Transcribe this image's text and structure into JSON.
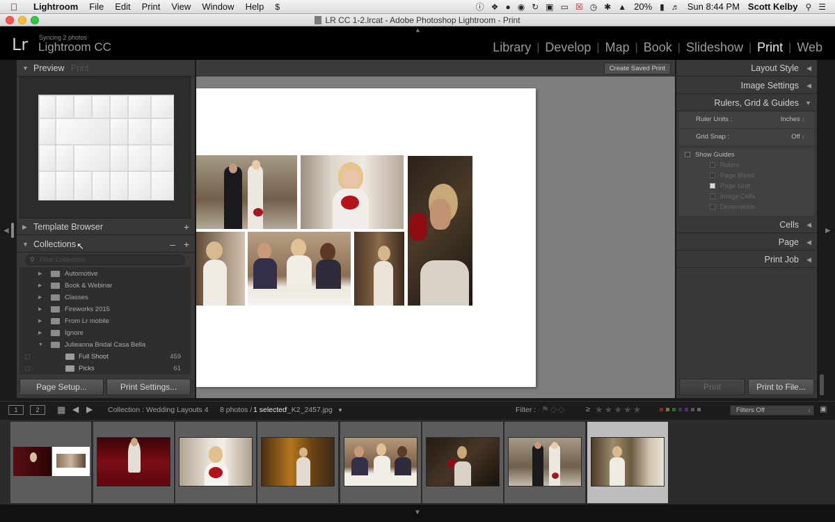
{
  "menubar": {
    "apple": "",
    "items": [
      "Lightroom",
      "File",
      "Edit",
      "Print",
      "View",
      "Window",
      "Help"
    ],
    "battery": "20%",
    "clock": "Sun 8:44 PM",
    "user": "Scott Kelby"
  },
  "window": {
    "title": "LR CC 1-2.lrcat - Adobe Photoshop Lightroom - Print"
  },
  "identity": {
    "logo": "Lr",
    "sync_status": "Syncing 2 photos",
    "product": "Lightroom CC"
  },
  "modules": [
    "Library",
    "Develop",
    "Map",
    "Book",
    "Slideshow",
    "Print",
    "Web"
  ],
  "active_module": "Print",
  "left_panel": {
    "preview": {
      "title": "Preview",
      "subtitle": "Print"
    },
    "template_browser": {
      "title": "Template Browser"
    },
    "collections": {
      "title": "Collections",
      "filter_placeholder": "Filter Collections",
      "items": [
        {
          "name": "Automotive",
          "expanded": false
        },
        {
          "name": "Book & Webinar",
          "expanded": false
        },
        {
          "name": "Classes",
          "expanded": false
        },
        {
          "name": "Fireworks 2015",
          "expanded": false
        },
        {
          "name": "From Lr mobile",
          "expanded": false
        },
        {
          "name": "Ignore",
          "expanded": false
        },
        {
          "name": "Julieanna Bridal Casa Bella",
          "expanded": true
        }
      ],
      "children": [
        {
          "name": "Full Shoot",
          "count": "459"
        },
        {
          "name": "Picks",
          "count": "61"
        }
      ]
    },
    "page_setup_label": "Page Setup...",
    "print_settings_label": "Print Settings..."
  },
  "center": {
    "create_saved_print_label": "Create Saved Print"
  },
  "right_panel": {
    "layout_style": "Layout Style",
    "image_settings": "Image Settings",
    "rulers_grid_guides": "Rulers, Grid & Guides",
    "ruler_units": {
      "label": "Ruler Units :",
      "value": "Inches"
    },
    "grid_snap": {
      "label": "Grid Snap :",
      "value": "Off"
    },
    "show_guides": {
      "label": "Show Guides",
      "checked": false
    },
    "guides": [
      {
        "label": "Rulers",
        "checked": false
      },
      {
        "label": "Page Bleed",
        "checked": false
      },
      {
        "label": "Page Grid",
        "checked": true
      },
      {
        "label": "Image Cells",
        "checked": false
      },
      {
        "label": "Dimensions",
        "checked": false
      }
    ],
    "cells": "Cells",
    "page": "Page",
    "print_job": "Print Job",
    "print_label": "Print",
    "print_to_file_label": "Print to File..."
  },
  "filmstrip_bar": {
    "view1": "1",
    "view2": "2",
    "collection_label": "Collection : Wedding Layouts 4",
    "photos_count": "8 photos /",
    "selected": "1 selected",
    "filename": "/_K2_2457.jpg",
    "filter_label": "Filter :",
    "filters_off": "Filters Off"
  },
  "filmstrip": {
    "thumbnails": [
      "print-layout",
      "bride-red-staircase",
      "bride-roses-columns",
      "bride-window-curtains",
      "three-bridesmaids-table",
      "bride-dark-portrait",
      "couple-garden",
      "bride-profile-selected"
    ],
    "selected_index": 7
  },
  "colors": {
    "accent_light": "#eaeaea",
    "panel": "#383838",
    "workspace": "#7e7e7e"
  }
}
